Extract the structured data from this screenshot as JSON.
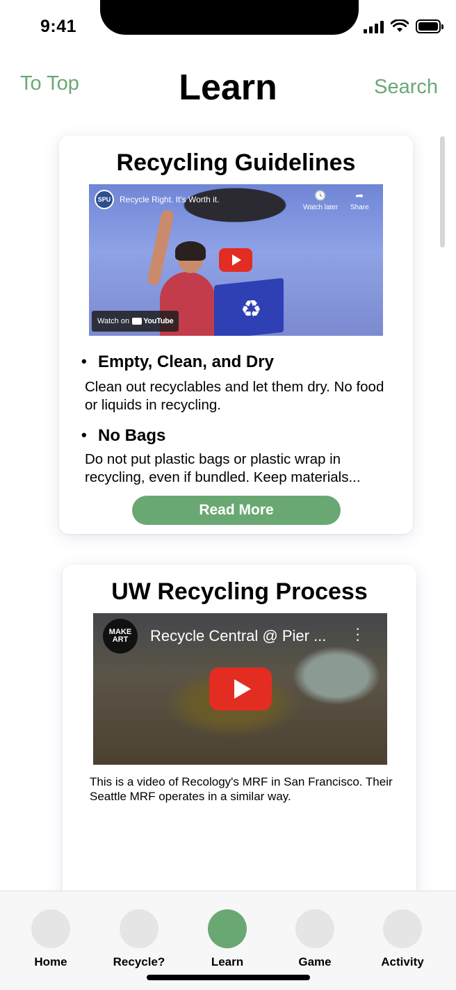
{
  "status_bar": {
    "time": "9:41"
  },
  "header": {
    "to_top": "To Top",
    "title": "Learn",
    "search": "Search"
  },
  "guidelines_card": {
    "title": "Recycling Guidelines",
    "video": {
      "title": "Recycle Right. It's Worth it.",
      "watch_later": "Watch later",
      "share": "Share",
      "watch_on": "Watch on",
      "youtube": "YouTube"
    },
    "items": [
      {
        "heading": "Empty, Clean, and Dry",
        "text": "Clean out recyclables and let them dry. No food or liquids in recycling."
      },
      {
        "heading": "No Bags",
        "text": "Do not put plastic bags or plastic wrap in recycling, even if bundled. Keep materials..."
      }
    ],
    "read_more": "Read More"
  },
  "process_card": {
    "title": "UW Recycling Process",
    "video": {
      "title": "Recycle Central @ Pier ...",
      "channel_logo": "MAKE ART"
    },
    "caption": "This is a video of Recology's MRF in San Francisco. Their Seattle MRF operates in a similar way."
  },
  "tabs": [
    {
      "label": "Home",
      "active": false
    },
    {
      "label": "Recycle?",
      "active": false
    },
    {
      "label": "Learn",
      "active": true
    },
    {
      "label": "Game",
      "active": false
    },
    {
      "label": "Activity",
      "active": false
    }
  ],
  "colors": {
    "accent": "#6aa873",
    "inactive_tab": "#e5e5e5",
    "youtube_red": "#e32c22"
  }
}
